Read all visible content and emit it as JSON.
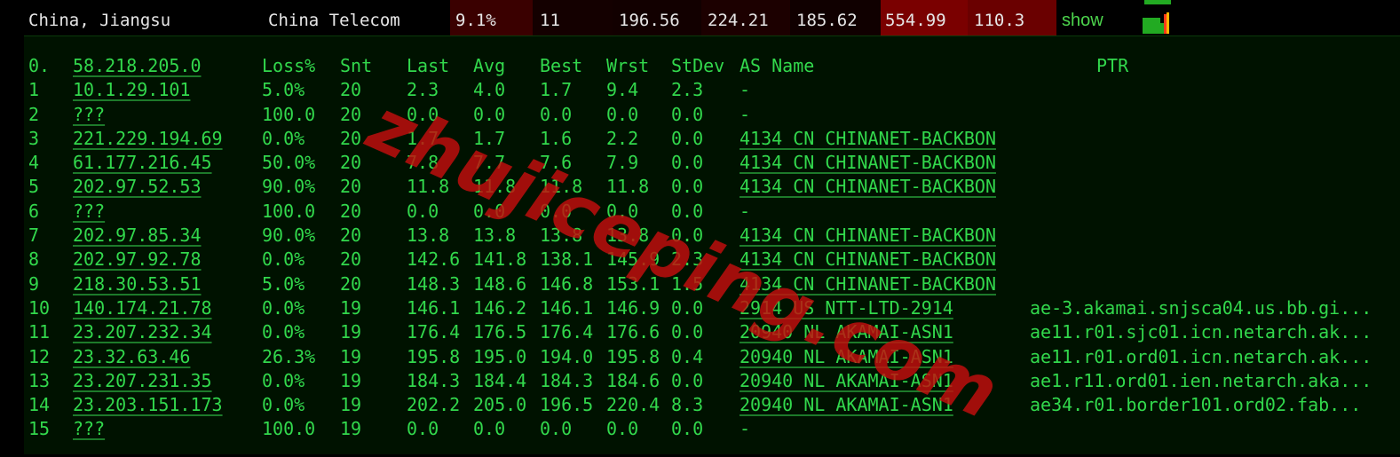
{
  "summary": {
    "location": "China, Jiangsu",
    "isp": "China Telecom",
    "loss": "9.1%",
    "sent": "11",
    "last": "196.56",
    "avg": "224.21",
    "best": "185.62",
    "worst": "554.99",
    "stdev": "110.3",
    "action": "show"
  },
  "table": {
    "headers": {
      "hop": "0.",
      "host": "58.218.205.0",
      "loss": "Loss%",
      "snt": "Snt",
      "last": "Last",
      "avg": "Avg",
      "best": "Best",
      "wrst": "Wrst",
      "stdev": "StDev",
      "as": "AS Name",
      "ptr": "PTR"
    },
    "rows": [
      {
        "hop": "1",
        "host": "10.1.29.101",
        "loss": "5.0%",
        "snt": "20",
        "last": "2.3",
        "avg": "4.0",
        "best": "1.7",
        "wrst": "9.4",
        "stdev": "2.3",
        "as": "-",
        "ptr": ""
      },
      {
        "hop": "2",
        "host": "???",
        "loss": "100.0",
        "snt": "20",
        "last": "0.0",
        "avg": "0.0",
        "best": "0.0",
        "wrst": "0.0",
        "stdev": "0.0",
        "as": "-",
        "ptr": ""
      },
      {
        "hop": "3",
        "host": "221.229.194.69",
        "loss": "0.0%",
        "snt": "20",
        "last": "1.7",
        "avg": "1.7",
        "best": "1.6",
        "wrst": "2.2",
        "stdev": "0.0",
        "as": "4134  CN CHINANET-BACKBON",
        "ptr": ""
      },
      {
        "hop": "4",
        "host": "61.177.216.45",
        "loss": "50.0%",
        "snt": "20",
        "last": "7.8",
        "avg": "7.7",
        "best": "7.6",
        "wrst": "7.9",
        "stdev": "0.0",
        "as": "4134  CN CHINANET-BACKBON",
        "ptr": ""
      },
      {
        "hop": "5",
        "host": "202.97.52.53",
        "loss": "90.0%",
        "snt": "20",
        "last": "11.8",
        "avg": "11.8",
        "best": "11.8",
        "wrst": "11.8",
        "stdev": "0.0",
        "as": "4134  CN CHINANET-BACKBON",
        "ptr": ""
      },
      {
        "hop": "6",
        "host": "???",
        "loss": "100.0",
        "snt": "20",
        "last": "0.0",
        "avg": "0.0",
        "best": "0.0",
        "wrst": "0.0",
        "stdev": "0.0",
        "as": "-",
        "ptr": ""
      },
      {
        "hop": "7",
        "host": "202.97.85.34",
        "loss": "90.0%",
        "snt": "20",
        "last": "13.8",
        "avg": "13.8",
        "best": "13.8",
        "wrst": "13.8",
        "stdev": "0.0",
        "as": "4134  CN CHINANET-BACKBON",
        "ptr": ""
      },
      {
        "hop": "8",
        "host": "202.97.92.78",
        "loss": "0.0%",
        "snt": "20",
        "last": "142.6",
        "avg": "141.8",
        "best": "138.1",
        "wrst": "145.9",
        "stdev": "2.3",
        "as": "4134  CN CHINANET-BACKBON",
        "ptr": ""
      },
      {
        "hop": "9",
        "host": "218.30.53.51",
        "loss": "5.0%",
        "snt": "20",
        "last": "148.3",
        "avg": "148.6",
        "best": "146.8",
        "wrst": "153.1",
        "stdev": "1.5",
        "as": "4134  CN CHINANET-BACKBON",
        "ptr": ""
      },
      {
        "hop": "10",
        "host": "140.174.21.78",
        "loss": "0.0%",
        "snt": "19",
        "last": "146.1",
        "avg": "146.2",
        "best": "146.1",
        "wrst": "146.9",
        "stdev": "0.0",
        "as": "2914  US NTT-LTD-2914",
        "ptr": "ae-3.akamai.snjsca04.us.bb.gi..."
      },
      {
        "hop": "11",
        "host": "23.207.232.34",
        "loss": "0.0%",
        "snt": "19",
        "last": "176.4",
        "avg": "176.5",
        "best": "176.4",
        "wrst": "176.6",
        "stdev": "0.0",
        "as": "20940 NL AKAMAI-ASN1",
        "ptr": "ae11.r01.sjc01.icn.netarch.ak..."
      },
      {
        "hop": "12",
        "host": "23.32.63.46",
        "loss": "26.3%",
        "snt": "19",
        "last": "195.8",
        "avg": "195.0",
        "best": "194.0",
        "wrst": "195.8",
        "stdev": "0.4",
        "as": "20940 NL AKAMAI-ASN1",
        "ptr": "ae11.r01.ord01.icn.netarch.ak..."
      },
      {
        "hop": "13",
        "host": "23.207.231.35",
        "loss": "0.0%",
        "snt": "19",
        "last": "184.3",
        "avg": "184.4",
        "best": "184.3",
        "wrst": "184.6",
        "stdev": "0.0",
        "as": "20940 NL AKAMAI-ASN1",
        "ptr": "ae1.r11.ord01.ien.netarch.aka..."
      },
      {
        "hop": "14",
        "host": "23.203.151.173",
        "loss": "0.0%",
        "snt": "19",
        "last": "202.2",
        "avg": "205.0",
        "best": "196.5",
        "wrst": "220.4",
        "stdev": "8.3",
        "as": "20940 NL AKAMAI-ASN1",
        "ptr": "ae34.r01.border101.ord02.fab..."
      },
      {
        "hop": "15",
        "host": "???",
        "loss": "100.0",
        "snt": "19",
        "last": "0.0",
        "avg": "0.0",
        "best": "0.0",
        "wrst": "0.0",
        "stdev": "0.0",
        "as": "-",
        "ptr": ""
      }
    ]
  },
  "watermark": "zhujiceping.com",
  "colors": {
    "terminal_text": "#32d84c",
    "panel_bg": "#001200",
    "watermark": "#c40e0e",
    "cell_heat_dark": "#3a0000",
    "cell_heat_bright": "#7a0000",
    "show_link": "#4cd44c",
    "bar_green": "#22aa22"
  },
  "icons": {
    "latency_bar": "mini-bar-chart-icon"
  }
}
